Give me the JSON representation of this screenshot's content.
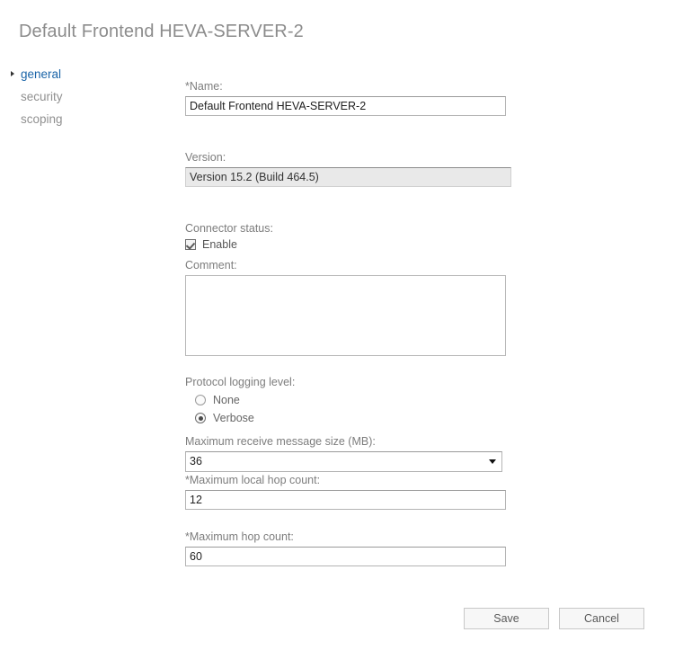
{
  "page": {
    "title": "Default Frontend HEVA-SERVER-2"
  },
  "nav": {
    "items": [
      {
        "label": "general",
        "active": true
      },
      {
        "label": "security",
        "active": false
      },
      {
        "label": "scoping",
        "active": false
      }
    ]
  },
  "form": {
    "name": {
      "label": "*Name:",
      "value": "Default Frontend HEVA-SERVER-2",
      "placeholder": ""
    },
    "version": {
      "label": "Version:",
      "value": "Version 15.2 (Build 464.5)"
    },
    "connector_status": {
      "label": "Connector status:",
      "enable_label": "Enable",
      "enabled": true
    },
    "comment": {
      "label": "Comment:",
      "value": "",
      "placeholder": ""
    },
    "protocol_logging": {
      "label": "Protocol logging level:",
      "options": [
        {
          "label": "None",
          "selected": false
        },
        {
          "label": "Verbose",
          "selected": true
        }
      ],
      "selected": "Verbose"
    },
    "max_receive_message_size": {
      "label": "Maximum receive message size (MB):",
      "value": "36"
    },
    "max_local_hop_count": {
      "label": "*Maximum local hop count:",
      "value": "12"
    },
    "max_hop_count": {
      "label": "*Maximum hop count:",
      "value": "60"
    }
  },
  "buttons": {
    "save": "Save",
    "cancel": "Cancel"
  },
  "colors": {
    "accent": "#1a64a8",
    "title": "#8c8c8c",
    "label": "#7d7d7d"
  }
}
